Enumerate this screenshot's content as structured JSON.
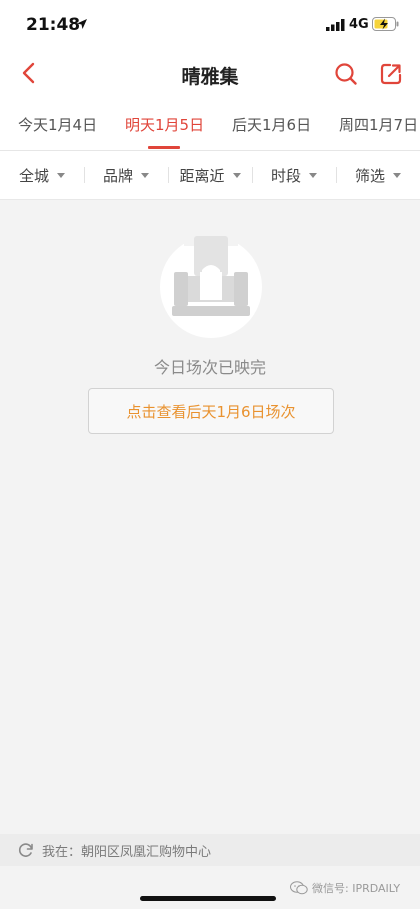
{
  "status_bar": {
    "time": "21:48",
    "network": "4G"
  },
  "nav": {
    "title": "晴雅集"
  },
  "date_tabs": [
    {
      "label": "今天1月4日"
    },
    {
      "label": "明天1月5日"
    },
    {
      "label": "后天1月6日"
    },
    {
      "label": "周四1月7日"
    }
  ],
  "active_tab_index": 1,
  "filters": [
    {
      "label": "全城"
    },
    {
      "label": "品牌"
    },
    {
      "label": "距离近"
    },
    {
      "label": "时段"
    },
    {
      "label": "筛选"
    }
  ],
  "empty_state": {
    "message": "今日场次已映完",
    "button_label": "点击查看后天1月6日场次"
  },
  "location": {
    "text": "我在：朝阳区凤凰汇购物中心"
  },
  "watermark": {
    "text": "微信号: IPRDAILY"
  },
  "colors": {
    "accent": "#e0453a",
    "button_text": "#e9922f"
  }
}
